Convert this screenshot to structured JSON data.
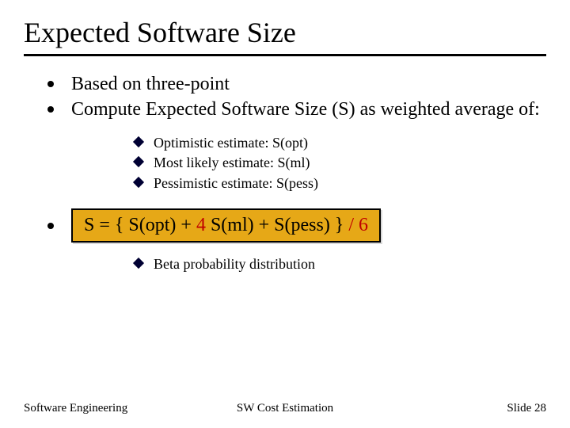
{
  "title": "Expected Software Size",
  "bullets": [
    "Based on three-point",
    "Compute Expected Software Size (S) as weighted average of:"
  ],
  "sub_bullets_1": [
    "Optimistic estimate: S(opt)",
    "Most likely estimate: S(ml)",
    "Pessimistic estimate: S(pess)"
  ],
  "formula": {
    "p1": "S = { S(opt) + ",
    "p2_red": "4",
    "p3": " S(ml) + S(pess) } ",
    "p4_red": "/ 6"
  },
  "sub_bullets_2": [
    "Beta probability distribution"
  ],
  "footer": {
    "left": "Software Engineering",
    "center": "SW Cost Estimation",
    "right": "Slide 28"
  }
}
